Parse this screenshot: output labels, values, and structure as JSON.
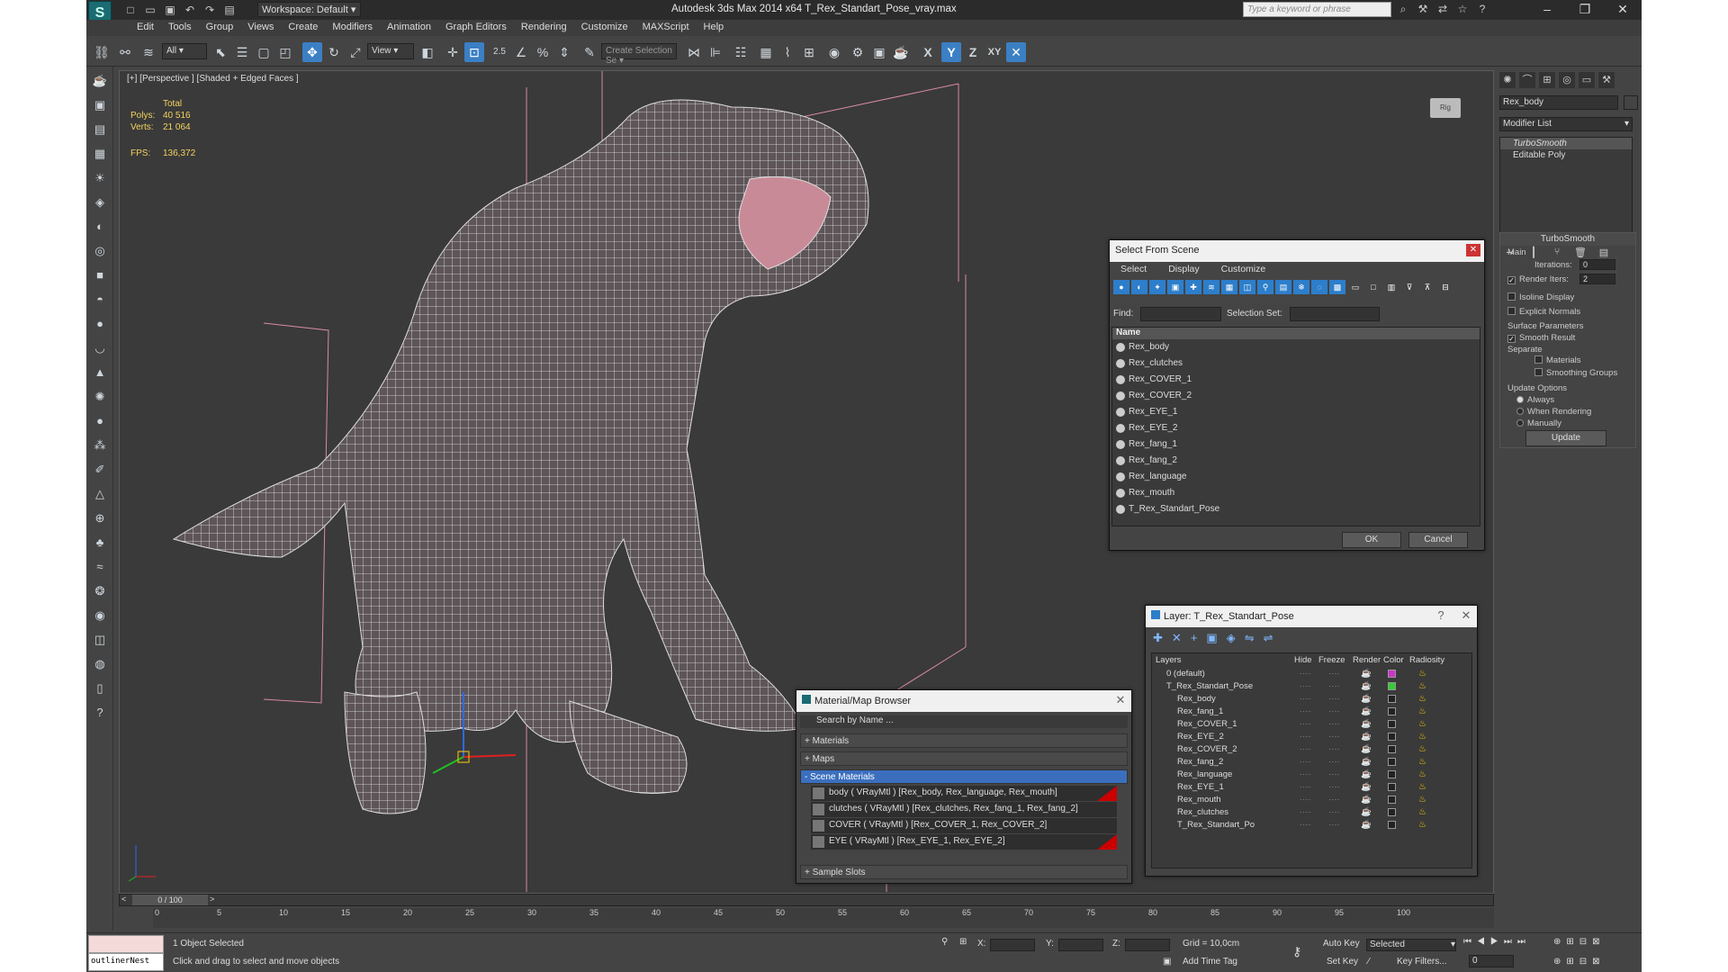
{
  "titlebar": {
    "workspace": "Workspace: Default",
    "app_title": "Autodesk 3ds Max  2014 x64    T_Rex_Standart_Pose_vray.max",
    "search_placeholder": "Type a keyword or phrase"
  },
  "menu": [
    "Edit",
    "Tools",
    "Group",
    "Views",
    "Create",
    "Modifiers",
    "Animation",
    "Graph Editors",
    "Rendering",
    "Customize",
    "MAXScript",
    "Help"
  ],
  "toolbar": {
    "filter": "All",
    "ref_coord": "View",
    "snap_label": "2.5",
    "create_selection_set": "Create Selection Se",
    "axis_x": "X",
    "axis_y": "Y",
    "axis_z": "Z",
    "axis_xy": "XY"
  },
  "viewport": {
    "label": "[+] [Perspective ] [Shaded + Edged Faces ]",
    "stats": {
      "total": "Total",
      "polys_label": "Polys:",
      "polys": "40 516",
      "verts_label": "Verts:",
      "verts": "21 064",
      "fps_label": "FPS:",
      "fps": "136,372"
    },
    "viewcube_label": "Rig"
  },
  "command_panel": {
    "object_name": "Rex_body",
    "modifier_list": "Modifier List",
    "stack": [
      "TurboSmooth",
      "Editable Poly"
    ],
    "rollout_title": "TurboSmooth",
    "main_label": "Main",
    "iterations_label": "Iterations:",
    "iterations_value": "0",
    "render_iters_label": "Render Iters:",
    "render_iters_value": "2",
    "isoline": "Isoline Display",
    "explicit_normals": "Explicit Normals",
    "surface_params": "Surface Parameters",
    "smooth_result": "Smooth Result",
    "separate": "Separate",
    "materials": "Materials",
    "smoothing_groups": "Smoothing Groups",
    "update_options": "Update Options",
    "always": "Always",
    "when_rendering": "When Rendering",
    "manually": "Manually",
    "update_btn": "Update"
  },
  "select_from_scene": {
    "title": "Select From Scene",
    "menu": [
      "Select",
      "Display",
      "Customize"
    ],
    "find_label": "Find:",
    "selection_set_label": "Selection Set:",
    "column_name": "Name",
    "items": [
      "Rex_body",
      "Rex_clutches",
      "Rex_COVER_1",
      "Rex_COVER_2",
      "Rex_EYE_1",
      "Rex_EYE_2",
      "Rex_fang_1",
      "Rex_fang_2",
      "Rex_language",
      "Rex_mouth",
      "T_Rex_Standart_Pose"
    ],
    "ok": "OK",
    "cancel": "Cancel"
  },
  "layer_dialog": {
    "title": "Layer: T_Rex_Standart_Pose",
    "columns": [
      "Layers",
      "Hide",
      "Freeze",
      "Render",
      "Color",
      "Radiosity"
    ],
    "rows": [
      {
        "name": "0 (default)",
        "indent": 0,
        "color": "#cc33cc"
      },
      {
        "name": "T_Rex_Standart_Pose",
        "indent": 0,
        "color": "#33cc33"
      },
      {
        "name": "Rex_body",
        "indent": 1,
        "color": ""
      },
      {
        "name": "Rex_fang_1",
        "indent": 1,
        "color": ""
      },
      {
        "name": "Rex_COVER_1",
        "indent": 1,
        "color": ""
      },
      {
        "name": "Rex_EYE_2",
        "indent": 1,
        "color": ""
      },
      {
        "name": "Rex_COVER_2",
        "indent": 1,
        "color": ""
      },
      {
        "name": "Rex_fang_2",
        "indent": 1,
        "color": ""
      },
      {
        "name": "Rex_language",
        "indent": 1,
        "color": ""
      },
      {
        "name": "Rex_EYE_1",
        "indent": 1,
        "color": ""
      },
      {
        "name": "Rex_mouth",
        "indent": 1,
        "color": ""
      },
      {
        "name": "Rex_clutches",
        "indent": 1,
        "color": ""
      },
      {
        "name": "T_Rex_Standart_Po",
        "indent": 1,
        "color": ""
      }
    ]
  },
  "material_browser": {
    "title": "Material/Map Browser",
    "search": "Search by Name ...",
    "groups": [
      "+ Materials",
      "+ Maps",
      "- Scene Materials"
    ],
    "scene_materials": [
      "body  ( VRayMtl ) [Rex_body, Rex_language, Rex_mouth]",
      "clutches  ( VRayMtl ) [Rex_clutches, Rex_fang_1, Rex_fang_2]",
      "COVER  ( VRayMtl ) [Rex_COVER_1, Rex_COVER_2]",
      "EYE  ( VRayMtl ) [Rex_EYE_1, Rex_EYE_2]"
    ],
    "sample_slots": "+ Sample Slots"
  },
  "timeline": {
    "frame": "0 / 100",
    "ticks": [
      "0",
      "5",
      "10",
      "15",
      "20",
      "25",
      "30",
      "35",
      "40",
      "45",
      "50",
      "55",
      "60",
      "65",
      "70",
      "75",
      "80",
      "85",
      "90",
      "95",
      "100"
    ]
  },
  "status": {
    "script_text": "outlinerNest",
    "selected": "1 Object Selected",
    "prompt": "Click and drag to select and move objects",
    "x_label": "X:",
    "y_label": "Y:",
    "z_label": "Z:",
    "grid": "Grid = 10,0cm",
    "add_time_tag": "Add Time Tag",
    "auto_key": "Auto Key",
    "set_key": "Set Key",
    "selected_dropdown": "Selected",
    "key_filters": "Key Filters...",
    "frame_value": "0"
  }
}
